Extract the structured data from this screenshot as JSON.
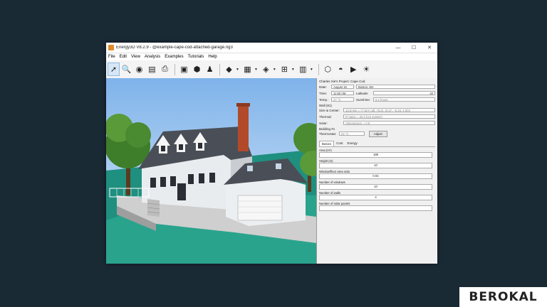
{
  "window": {
    "title": "Energy3D V8.2.9 - @example-cape-cod-attached-garage.ng3",
    "minimize": "—",
    "maximize": "☐",
    "close": "✕"
  },
  "menu": [
    "File",
    "Edit",
    "View",
    "Analysis",
    "Examples",
    "Tutorials",
    "Help"
  ],
  "panel": {
    "header": "Charles Xie's  Project: Cape Cod",
    "date_label": "Date:",
    "date_value": "August 15",
    "location_value": "Boston, MA",
    "time_label": "Time:",
    "time_value": "11:50 AM",
    "latitude_label": "Latitude:",
    "latitude_value": "42",
    "temp_label": "Temp.:",
    "temp_value": "27 °C",
    "sunshine_label": "Sunshine:",
    "sunshine_value": "9.2 hours",
    "wall_section": "Wall (81)",
    "size_label": "Size & Center:",
    "size_value": "15.5×5m ≈ 77.5m² (aft. 75.6), (0.27, −6.19, 4.5)m",
    "thermal_label": "Thermal:",
    "thermal_value": "R-Value = 20.3 (US system)",
    "solar_label": "Solar:",
    "solar_value": "Absorptance = 0.8",
    "building_section": "Building #1",
    "thermostat_label": "Thermostat:",
    "thermostat_value": "22 °C",
    "adjust_button": "Adjust",
    "tabs": [
      "Basics",
      "Cost",
      "Energy"
    ],
    "props": [
      {
        "label": "Area (m²)",
        "value": "188"
      },
      {
        "label": "Height (m)",
        "value": "10"
      },
      {
        "label": "Window/floor area ratio",
        "value": "0.04"
      },
      {
        "label": "Number of windows",
        "value": "10"
      },
      {
        "label": "Number of walls",
        "value": "4"
      },
      {
        "label": "Number of solar panels",
        "value": ""
      }
    ]
  },
  "watermark": "BEROKAL"
}
